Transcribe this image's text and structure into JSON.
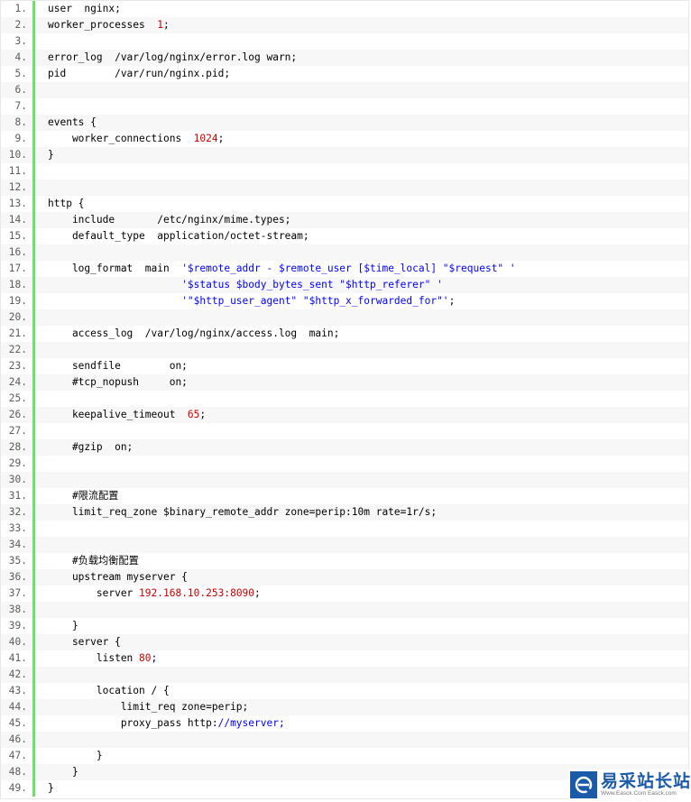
{
  "lines": [
    [
      [
        "user  nginx;"
      ]
    ],
    [
      [
        "worker_processes  "
      ],
      [
        "1",
        "num"
      ],
      [
        ";"
      ]
    ],
    [
      [
        ""
      ]
    ],
    [
      [
        "error_log  /var/log/nginx/error.log warn;"
      ]
    ],
    [
      [
        "pid        /var/run/nginx.pid;"
      ]
    ],
    [
      [
        ""
      ]
    ],
    [
      [
        ""
      ]
    ],
    [
      [
        "events {"
      ]
    ],
    [
      [
        "    worker_connections  "
      ],
      [
        "1024",
        "num"
      ],
      [
        ";"
      ]
    ],
    [
      [
        "}"
      ]
    ],
    [
      [
        ""
      ]
    ],
    [
      [
        ""
      ]
    ],
    [
      [
        "http {"
      ]
    ],
    [
      [
        "    include       /etc/nginx/mime.types;"
      ]
    ],
    [
      [
        "    default_type  application/octet-stream;"
      ]
    ],
    [
      [
        ""
      ]
    ],
    [
      [
        "    log_format  main  "
      ],
      [
        "'$remote_addr - $remote_user [$time_local] \"$request\" '",
        "str"
      ]
    ],
    [
      [
        "                      "
      ],
      [
        "'$status $body_bytes_sent \"$http_referer\" '",
        "str"
      ]
    ],
    [
      [
        "                      "
      ],
      [
        "'\"$http_user_agent\" \"$http_x_forwarded_for\"'",
        "str"
      ],
      [
        ";"
      ]
    ],
    [
      [
        ""
      ]
    ],
    [
      [
        "    access_log  /var/log/nginx/access.log  main;"
      ]
    ],
    [
      [
        ""
      ]
    ],
    [
      [
        "    sendfile        on;"
      ]
    ],
    [
      [
        "    #tcp_nopush     on;"
      ]
    ],
    [
      [
        ""
      ]
    ],
    [
      [
        "    keepalive_timeout  "
      ],
      [
        "65",
        "num"
      ],
      [
        ";"
      ]
    ],
    [
      [
        ""
      ]
    ],
    [
      [
        "    #gzip  on;"
      ]
    ],
    [
      [
        ""
      ]
    ],
    [
      [
        ""
      ]
    ],
    [
      [
        "    #限流配置"
      ]
    ],
    [
      [
        "    limit_req_zone $binary_remote_addr zone=perip:10m rate=1r/s;"
      ]
    ],
    [
      [
        ""
      ]
    ],
    [
      [
        ""
      ]
    ],
    [
      [
        "    #负载均衡配置"
      ]
    ],
    [
      [
        "    upstream myserver {"
      ]
    ],
    [
      [
        "        server "
      ],
      [
        "192.168.10.253:8090",
        "num"
      ],
      [
        ";"
      ]
    ],
    [
      [
        ""
      ]
    ],
    [
      [
        "    }"
      ]
    ],
    [
      [
        "    server {"
      ]
    ],
    [
      [
        "        listen "
      ],
      [
        "80",
        "num"
      ],
      [
        ";"
      ]
    ],
    [
      [
        ""
      ]
    ],
    [
      [
        "        location / {"
      ]
    ],
    [
      [
        "            limit_req zone=perip;"
      ]
    ],
    [
      [
        "            proxy_pass http:"
      ],
      [
        "//myserver;",
        "str"
      ]
    ],
    [
      [
        ""
      ]
    ],
    [
      [
        "        }"
      ]
    ],
    [
      [
        "    }"
      ]
    ],
    [
      [
        "}"
      ]
    ]
  ],
  "watermark": {
    "cn": "易采站长站",
    "en": "Www.Easck.Com Easck.com"
  },
  "colors": {
    "gutter_border": "#6ce26c",
    "number": "#cc0000",
    "string": "#0000ff",
    "brand": "#1a5aa8"
  }
}
